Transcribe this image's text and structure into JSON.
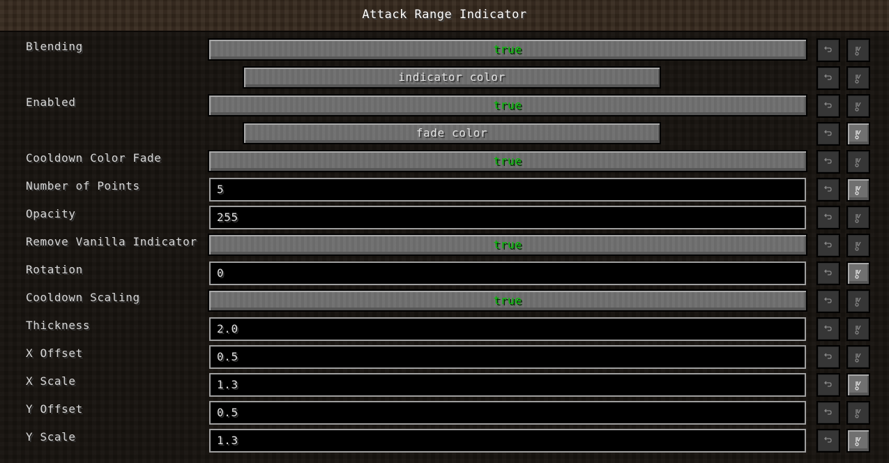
{
  "title": "Attack Range Indicator",
  "icons": {
    "undo": "undo-arrow-icon",
    "reset": "reset-icon"
  },
  "colors": {
    "boolean_true": "#00bf00",
    "button_bg": "#6e6e6e",
    "input_border": "#a0a0a0"
  },
  "rows": [
    {
      "label": "Blending",
      "type": "toggle",
      "value": "true",
      "reset_enabled": false
    },
    {
      "label": "",
      "type": "subbutton",
      "value": "indicator color",
      "reset_enabled": false
    },
    {
      "label": "Enabled",
      "type": "toggle",
      "value": "true",
      "reset_enabled": false
    },
    {
      "label": "",
      "type": "subbutton",
      "value": "fade color",
      "reset_enabled": true
    },
    {
      "label": "Cooldown Color Fade",
      "type": "toggle",
      "value": "true",
      "reset_enabled": false
    },
    {
      "label": "Number of Points",
      "type": "input",
      "value": "5",
      "reset_enabled": true
    },
    {
      "label": "Opacity",
      "type": "input",
      "value": "255",
      "reset_enabled": false
    },
    {
      "label": "Remove Vanilla Indicator",
      "type": "toggle",
      "value": "true",
      "reset_enabled": false
    },
    {
      "label": "Rotation",
      "type": "input",
      "value": "0",
      "reset_enabled": true
    },
    {
      "label": "Cooldown Scaling",
      "type": "toggle",
      "value": "true",
      "reset_enabled": false
    },
    {
      "label": "Thickness",
      "type": "input",
      "value": "2.0",
      "reset_enabled": false
    },
    {
      "label": "X Offset",
      "type": "input",
      "value": "0.5",
      "reset_enabled": false
    },
    {
      "label": "X Scale",
      "type": "input",
      "value": "1.3",
      "reset_enabled": true
    },
    {
      "label": "Y Offset",
      "type": "input",
      "value": "0.5",
      "reset_enabled": false
    },
    {
      "label": "Y Scale",
      "type": "input",
      "value": "1.3",
      "reset_enabled": true
    }
  ]
}
